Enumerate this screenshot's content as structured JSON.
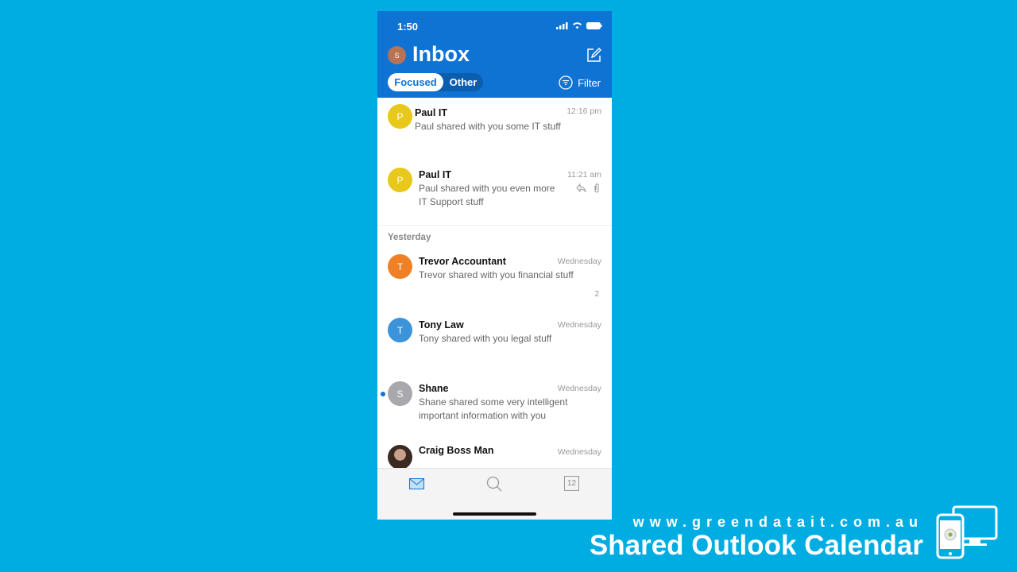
{
  "status_bar": {
    "time": "1:50"
  },
  "header": {
    "title": "Inbox",
    "account_initial": "S",
    "tabs": {
      "focused": "Focused",
      "other": "Other"
    },
    "filter_label": "Filter"
  },
  "colors": {
    "brand_blue": "#0f73d4",
    "background": "#00ade2"
  },
  "messages": [
    {
      "initial": "P",
      "sender": "Paul IT",
      "time": "12:16 pm",
      "preview": "Paul shared with you some IT stuff",
      "avatar_color": "#e8c81a"
    },
    {
      "initial": "P",
      "sender": "Paul IT",
      "time": "11:21 am",
      "preview": "Paul shared with you even more IT Support stuff",
      "avatar_color": "#e8c81a",
      "icons": [
        "reply-icon",
        "attachment-icon"
      ]
    },
    {
      "initial": "T",
      "sender": "Trevor Accountant",
      "time": "Wednesday",
      "preview": "Trevor shared with you financial stuff",
      "avatar_color": "#f08025",
      "thread_count": "2"
    },
    {
      "initial": "T",
      "sender": "Tony Law",
      "time": "Wednesday",
      "preview": "Tony shared with you legal stuff",
      "avatar_color": "#3b93d9"
    },
    {
      "initial": "S",
      "sender": "Shane",
      "time": "Wednesday",
      "preview": "Shane shared some very intelligent important information with you",
      "avatar_color": "#a8a8ad",
      "unread": true
    },
    {
      "initial": "",
      "sender": "Craig Boss Man",
      "time": "Wednesday",
      "preview": "",
      "avatar_color": "#3a2a22"
    }
  ],
  "section_label": "Yesterday",
  "tabbar": {
    "items": [
      "mail-icon",
      "search-icon",
      "calendar-icon"
    ],
    "calendar_day": "12"
  },
  "branding": {
    "url": "www.greendatait.com.au",
    "title": "Shared Outlook Calendar"
  }
}
